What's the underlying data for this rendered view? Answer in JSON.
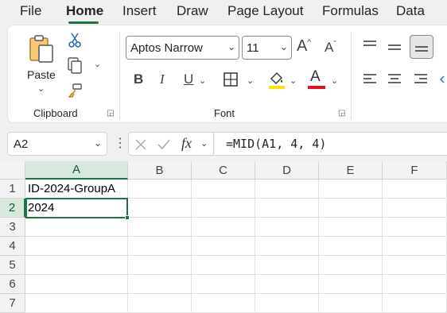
{
  "menu": {
    "tabs": [
      {
        "label": "File"
      },
      {
        "label": "Home"
      },
      {
        "label": "Insert"
      },
      {
        "label": "Draw"
      },
      {
        "label": "Page Layout"
      },
      {
        "label": "Formulas"
      },
      {
        "label": "Data"
      }
    ],
    "active": "Home"
  },
  "ribbon": {
    "clipboard": {
      "paste_label": "Paste",
      "group_label": "Clipboard"
    },
    "font": {
      "font_name": "Aptos Narrow",
      "font_size": "11",
      "group_label": "Font",
      "bold": "B",
      "italic": "I",
      "underline": "U",
      "font_color_letter": "A",
      "font_color": "#e81123",
      "fill_color": "#ffe100"
    }
  },
  "formula_bar": {
    "name_box": "A2",
    "fx": "fx",
    "formula": "=MID(A1, 4, 4)"
  },
  "sheet": {
    "columns": [
      "A",
      "B",
      "C",
      "D",
      "E",
      "F"
    ],
    "rows": [
      "1",
      "2",
      "3",
      "4",
      "5",
      "6",
      "7"
    ],
    "cells": {
      "A1": "ID-2024-GroupA",
      "A2": "2024"
    },
    "selected": "A2",
    "accent": "#217346"
  }
}
